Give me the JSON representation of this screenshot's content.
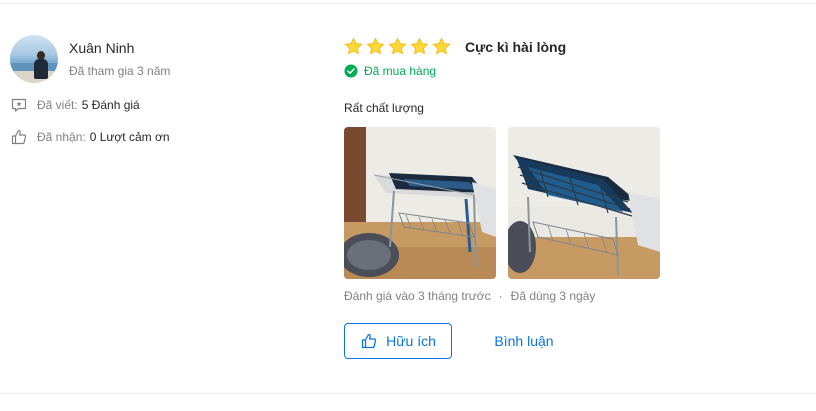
{
  "reviewer": {
    "name": "Xuân Ninh",
    "joined": "Đã tham gia 3 năm",
    "stats": [
      {
        "label": "Đã viết:",
        "value": "5 Đánh giá",
        "icon": "review-icon"
      },
      {
        "label": "Đã nhận:",
        "value": "0 Lượt cảm ơn",
        "icon": "thumbs-up-icon"
      }
    ]
  },
  "review": {
    "rating": 5,
    "rating_max": 5,
    "rating_title": "Cực kì hài lòng",
    "purchased_label": "Đã mua hàng",
    "content": "Rất chất lượng",
    "photo_count": 2,
    "reviewed_time": "Đánh giá vào 3 tháng trước",
    "separator": "·",
    "usage_time": "Đã dùng 3 ngày"
  },
  "actions": {
    "helpful_label": "Hữu ích",
    "comment_label": "Bình luận"
  },
  "colors": {
    "star": "#fdd836",
    "purchased": "#00ab56",
    "link": "#0b74e5",
    "muted": "#808089",
    "text": "#27272a"
  }
}
